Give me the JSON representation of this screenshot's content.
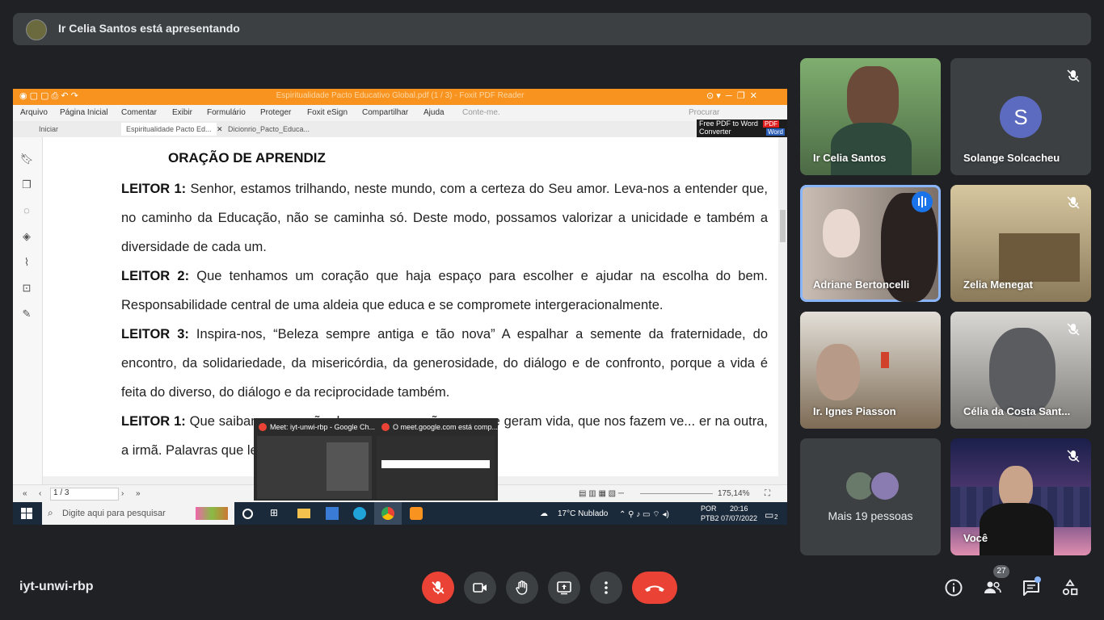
{
  "banner": {
    "text": "Ir Celia Santos está apresentando"
  },
  "app": {
    "title": "Espiritualidade Pacto Educativo Global.pdf (1 / 3) - Foxit PDF Reader",
    "menu": [
      "Arquivo",
      "Página Inicial",
      "Comentar",
      "Exibir",
      "Formulário",
      "Proteger",
      "Foxit eSign",
      "Compartilhar",
      "Ajuda",
      "Conte-me."
    ],
    "search_placeholder": "Procurar",
    "tabs": [
      "Iniciar",
      "Espiritualidade Pacto Ed...",
      "Dicionrio_Pacto_Educa..."
    ],
    "ad": {
      "line1": "Free PDF to Word",
      "line2": "Converter",
      "badge1": "PDF",
      "badge2": "Word"
    }
  },
  "document": {
    "heading": "ORAÇÃO DE APRENDIZ",
    "paragraphs": [
      {
        "label": "LEITOR 1:",
        "text": " Senhor, estamos trilhando, neste mundo, com a certeza do Seu amor. Leva-nos a entender que, no caminho da Educação, não se caminha só. Deste modo, possamos valorizar a unicidade e também a diversidade de cada um."
      },
      {
        "label": "LEITOR 2:",
        "text": " Que tenhamos um coração que haja espaço para escolher e ajudar na escolha do bem. Responsabilidade central de uma aldeia que educa e se compromete intergeracionalmente."
      },
      {
        "label": "LEITOR 3:",
        "text": " Inspira-nos, “Beleza sempre antiga e tão nova” A espalhar a semente da fraternidade, do encontro, da solidariedade, da misericórdia, da generosidade, do diálogo e de confronto, porque a vida é feita do diverso, do diálogo e da reciprocidade também."
      },
      {
        "label": "LEITOR 1:",
        "text": " Que saibamos ... ração das novas gerações, as que geram vida, que nos fazem ve... er na outra, a irmã. Palavras que levam a"
      }
    ]
  },
  "statusbar": {
    "page": "1 / 3",
    "zoom": "175,14%"
  },
  "taskbar": {
    "search_placeholder": "Digite aqui para pesquisar",
    "weather": "17°C  Nublado",
    "lang1": "POR",
    "lang2": "PTB2",
    "time": "20:16",
    "date": "07/07/2022",
    "notif": "2"
  },
  "preview": {
    "item1": "Meet: iyt-unwi-rbp - Google Ch...",
    "item2": "O meet.google.com está comp..."
  },
  "participants": [
    {
      "name": "Ir Celia Santos",
      "muted": false
    },
    {
      "name": "Solange Solcacheu",
      "muted": true,
      "initial": "S"
    },
    {
      "name": "Adriane Bertoncelli",
      "muted": false,
      "speaking": true
    },
    {
      "name": "Zelia Menegat",
      "muted": true
    },
    {
      "name": "Ir. Ignes Piasson",
      "muted": false
    },
    {
      "name": "Célia da Costa Sant...",
      "muted": true
    },
    {
      "name": "Mais 19 pessoas",
      "muted": false
    },
    {
      "name": "Você",
      "muted": true
    }
  ],
  "bottom": {
    "meeting_code": "iyt-unwi-rbp",
    "people_count": "27"
  },
  "colors": {
    "bg": "#202124",
    "tile": "#3c4043",
    "red": "#ea4335",
    "accent": "#8ab4f8",
    "foxit": "#f7931e"
  }
}
